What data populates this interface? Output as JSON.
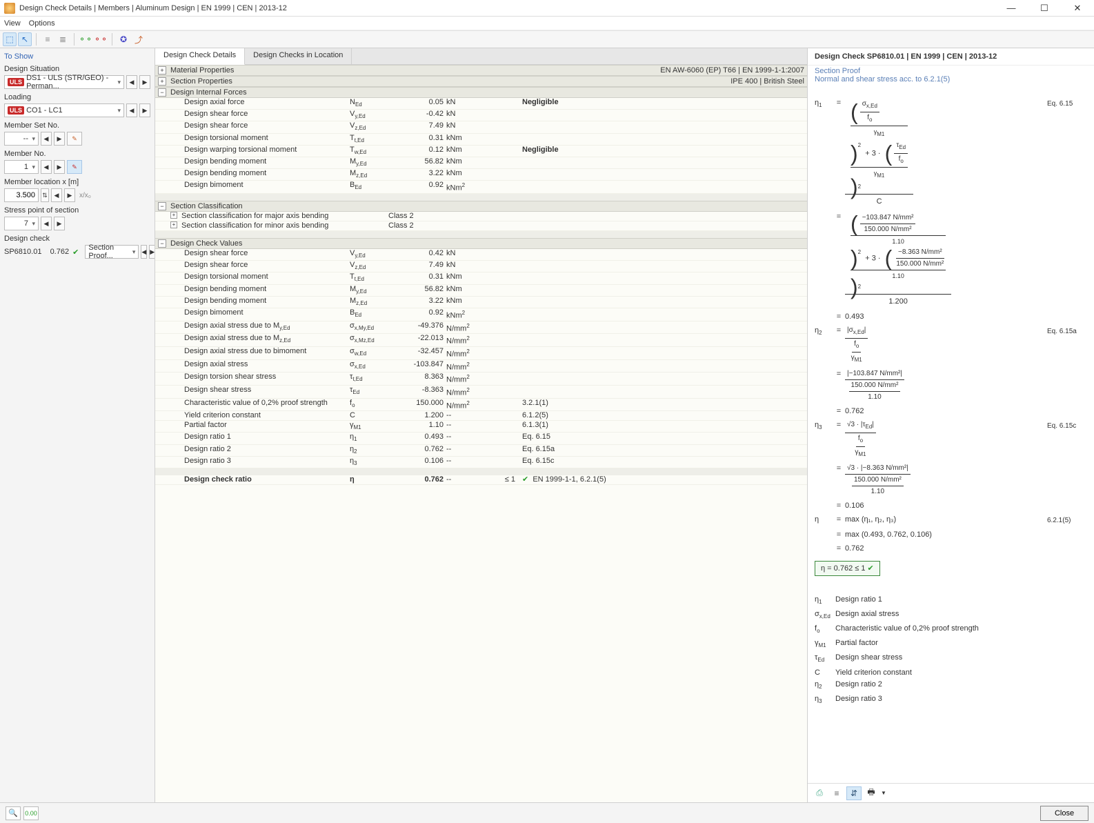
{
  "window": {
    "title": "Design Check Details | Members | Aluminum Design | EN 1999 | CEN | 2013-12"
  },
  "menu": {
    "view": "View",
    "options": "Options"
  },
  "sidebar": {
    "header": "To Show",
    "situation_label": "Design Situation",
    "situation_badge": "ULS",
    "situation_value": "DS1 - ULS (STR/GEO) - Perman...",
    "loading_label": "Loading",
    "loading_badge": "ULS",
    "loading_value": "CO1 - LC1",
    "memberset_label": "Member Set No.",
    "memberset_value": "--",
    "memberno_label": "Member No.",
    "memberno_value": "1",
    "location_label": "Member location x [m]",
    "location_value": "3.500",
    "location_xloc": "x/x₀",
    "stresspoint_label": "Stress point of section",
    "stresspoint_value": "7",
    "check_label": "Design check",
    "check_id": "SP6810.01",
    "check_ratio": "0.762",
    "check_desc": "Section Proof..."
  },
  "tabs": {
    "t1": "Design Check Details",
    "t2": "Design Checks in Location"
  },
  "groups": {
    "material": {
      "title": "Material Properties",
      "right": "EN AW-6060 (EP) T66 | EN 1999-1-1:2007"
    },
    "section": {
      "title": "Section Properties",
      "right": "IPE 400 | British Steel"
    },
    "forces": {
      "title": "Design Internal Forces"
    },
    "classif": {
      "title": "Section Classification"
    },
    "values": {
      "title": "Design Check Values"
    }
  },
  "forces": [
    {
      "label": "Design axial force",
      "sym": "N<sub>Ed</sub>",
      "val": "0.05",
      "unit": "kN",
      "note": "Negligible"
    },
    {
      "label": "Design shear force",
      "sym": "V<sub>y,Ed</sub>",
      "val": "-0.42",
      "unit": "kN",
      "note": ""
    },
    {
      "label": "Design shear force",
      "sym": "V<sub>z,Ed</sub>",
      "val": "7.49",
      "unit": "kN",
      "note": ""
    },
    {
      "label": "Design torsional moment",
      "sym": "T<sub>t,Ed</sub>",
      "val": "0.31",
      "unit": "kNm",
      "note": ""
    },
    {
      "label": "Design warping torsional moment",
      "sym": "T<sub>w,Ed</sub>",
      "val": "0.12",
      "unit": "kNm",
      "note": "Negligible"
    },
    {
      "label": "Design bending moment",
      "sym": "M<sub>y,Ed</sub>",
      "val": "56.82",
      "unit": "kNm",
      "note": ""
    },
    {
      "label": "Design bending moment",
      "sym": "M<sub>z,Ed</sub>",
      "val": "3.22",
      "unit": "kNm",
      "note": ""
    },
    {
      "label": "Design bimoment",
      "sym": "B<sub>Ed</sub>",
      "val": "0.92",
      "unit": "kNm<sup>2</sup>",
      "note": ""
    }
  ],
  "classif": [
    {
      "label": "Section classification for major axis bending",
      "val": "Class 2"
    },
    {
      "label": "Section classification for minor axis bending",
      "val": "Class 2"
    }
  ],
  "values": [
    {
      "label": "Design shear force",
      "sym": "V<sub>y,Ed</sub>",
      "val": "0.42",
      "unit": "kN",
      "note": ""
    },
    {
      "label": "Design shear force",
      "sym": "V<sub>z,Ed</sub>",
      "val": "7.49",
      "unit": "kN",
      "note": ""
    },
    {
      "label": "Design torsional moment",
      "sym": "T<sub>t,Ed</sub>",
      "val": "0.31",
      "unit": "kNm",
      "note": ""
    },
    {
      "label": "Design bending moment",
      "sym": "M<sub>y,Ed</sub>",
      "val": "56.82",
      "unit": "kNm",
      "note": ""
    },
    {
      "label": "Design bending moment",
      "sym": "M<sub>z,Ed</sub>",
      "val": "3.22",
      "unit": "kNm",
      "note": ""
    },
    {
      "label": "Design bimoment",
      "sym": "B<sub>Ed</sub>",
      "val": "0.92",
      "unit": "kNm<sup>2</sup>",
      "note": ""
    },
    {
      "label": "Design axial stress due to M<sub>y,Ed</sub>",
      "sym": "σ<sub>x,My,Ed</sub>",
      "val": "-49.376",
      "unit": "N/mm<sup>2</sup>",
      "note": ""
    },
    {
      "label": "Design axial stress due to M<sub>z,Ed</sub>",
      "sym": "σ<sub>x,Mz,Ed</sub>",
      "val": "-22.013",
      "unit": "N/mm<sup>2</sup>",
      "note": ""
    },
    {
      "label": "Design axial stress due to bimoment",
      "sym": "σ<sub>w,Ed</sub>",
      "val": "-32.457",
      "unit": "N/mm<sup>2</sup>",
      "note": ""
    },
    {
      "label": "Design axial stress",
      "sym": "σ<sub>x,Ed</sub>",
      "val": "-103.847",
      "unit": "N/mm<sup>2</sup>",
      "note": ""
    },
    {
      "label": "Design torsion shear stress",
      "sym": "τ<sub>t,Ed</sub>",
      "val": "8.363",
      "unit": "N/mm<sup>2</sup>",
      "note": ""
    },
    {
      "label": "Design shear stress",
      "sym": "τ<sub>Ed</sub>",
      "val": "-8.363",
      "unit": "N/mm<sup>2</sup>",
      "note": ""
    },
    {
      "label": "Characteristic value of 0,2% proof strength",
      "sym": "f<sub>o</sub>",
      "val": "150.000",
      "unit": "N/mm<sup>2</sup>",
      "note": "3.2.1(1)"
    },
    {
      "label": "Yield criterion constant",
      "sym": "C",
      "val": "1.200",
      "unit": "--",
      "note": "6.1.2(5)"
    },
    {
      "label": "Partial factor",
      "sym": "γ<sub>M1</sub>",
      "val": "1.10",
      "unit": "--",
      "note": "6.1.3(1)"
    },
    {
      "label": "Design ratio 1",
      "sym": "η<sub>1</sub>",
      "val": "0.493",
      "unit": "--",
      "note": "Eq. 6.15"
    },
    {
      "label": "Design ratio 2",
      "sym": "η<sub>2</sub>",
      "val": "0.762",
      "unit": "--",
      "note": "Eq. 6.15a"
    },
    {
      "label": "Design ratio 3",
      "sym": "η<sub>3</sub>",
      "val": "0.106",
      "unit": "--",
      "note": "Eq. 6.15c"
    }
  ],
  "final": {
    "label": "Design check ratio",
    "sym": "η",
    "val": "0.762",
    "unit": "--",
    "ref": "≤ 1",
    "note": "EN 1999-1-1, 6.2.1(5)"
  },
  "rightpane": {
    "title": "Design Check SP6810.01 | EN 1999 | CEN | 2013-12",
    "sub1": "Section Proof",
    "sub2": "Normal and shear stress acc. to 6.2.1(5)",
    "ref_615": "Eq. 6.15",
    "ref_615a": "Eq. 6.15a",
    "ref_615c": "Eq. 6.15c",
    "ref_6215": "6.2.1(5)",
    "eq_c": "C",
    "eq_cval": "1.200",
    "v_sigma": "−103.847 N/mm²",
    "v_tau": "−8.363 N/mm²",
    "v_fo": "150.000 N/mm²",
    "v_gamma": "1.10",
    "r1": "0.493",
    "r2": "0.762",
    "r3": "0.106",
    "max_line": "max (η₁, η₂, η₃)",
    "max_vals": "max (0.493, 0.762, 0.106)",
    "result": "η   =   0.762  ≤ 1",
    "legend": [
      {
        "sym": "η<sub>1</sub>",
        "desc": "Design ratio 1"
      },
      {
        "sym": "σ<sub>x,Ed</sub>",
        "desc": "Design axial stress"
      },
      {
        "sym": "f<sub>o</sub>",
        "desc": "Characteristic value of 0,2% proof strength"
      },
      {
        "sym": "γ<sub>M1</sub>",
        "desc": "Partial factor"
      },
      {
        "sym": "τ<sub>Ed</sub>",
        "desc": "Design shear stress"
      },
      {
        "sym": "C",
        "desc": "Yield criterion constant"
      },
      {
        "sym": "η<sub>2</sub>",
        "desc": "Design ratio 2"
      },
      {
        "sym": "η<sub>3</sub>",
        "desc": "Design ratio 3"
      }
    ]
  },
  "footer": {
    "close": "Close"
  }
}
